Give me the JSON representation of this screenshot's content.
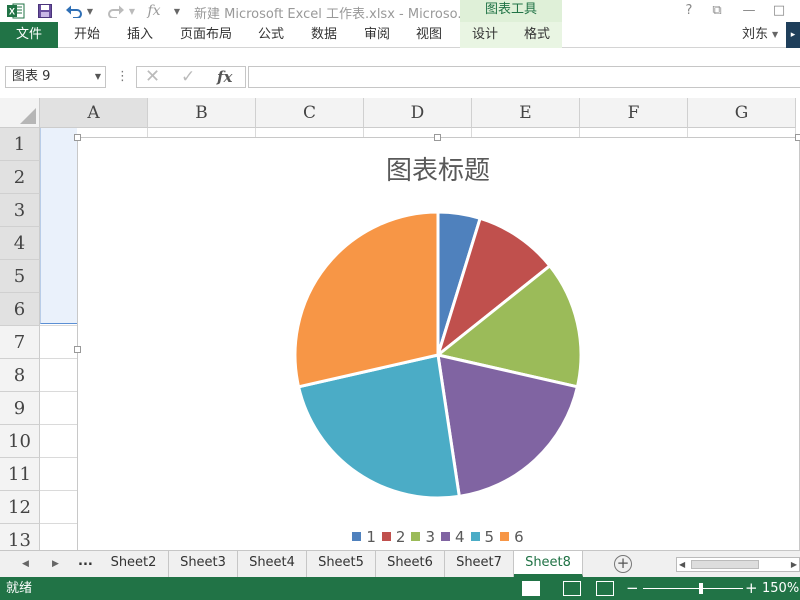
{
  "titlebar": {
    "document_title": "新建 Microsoft Excel 工作表.xlsx - Microso...",
    "context_group": "图表工具",
    "fx_label": "fx",
    "help": "?",
    "restore": "⧉",
    "minimize": "—",
    "close": "□"
  },
  "ribbon": {
    "file_tab": "文件",
    "tabs": [
      "开始",
      "插入",
      "页面布局",
      "公式",
      "数据",
      "审阅",
      "视图"
    ],
    "context_tabs": [
      "设计",
      "格式"
    ],
    "user": "刘东",
    "collapse_glyph": "▸"
  },
  "formula_bar": {
    "name_box": "图表 9",
    "grip": "⋮",
    "cancel": "✕",
    "enter": "✓",
    "insert_function": "fx",
    "formula": ""
  },
  "grid": {
    "columns": [
      "A",
      "B",
      "C",
      "D",
      "E",
      "F",
      "G"
    ],
    "rows": [
      "1",
      "2",
      "3",
      "4",
      "5",
      "6",
      "7",
      "8",
      "9",
      "10",
      "11",
      "12",
      "13"
    ],
    "selected_column": "A",
    "selected_rows": [
      "1",
      "2",
      "3",
      "4",
      "5",
      "6"
    ]
  },
  "chart_data": {
    "type": "pie",
    "title": "图表标题",
    "categories": [
      "1",
      "2",
      "3",
      "4",
      "5",
      "6"
    ],
    "values": [
      1,
      2,
      3,
      4,
      5,
      6
    ],
    "colors": [
      "#4f81bd",
      "#c0504d",
      "#9bbb59",
      "#8064a2",
      "#4bacc6",
      "#f79646"
    ],
    "legend_position": "bottom"
  },
  "sheet_tabs": {
    "ellipsis": "...",
    "tabs": [
      "Sheet2",
      "Sheet3",
      "Sheet4",
      "Sheet5",
      "Sheet6",
      "Sheet7",
      "Sheet8"
    ],
    "active": "Sheet8",
    "add_sheet": "+"
  },
  "status_bar": {
    "status": "就绪",
    "zoom_minus": "−",
    "zoom_plus": "+",
    "zoom": "150%",
    "zoom_value": 150
  },
  "colors": {
    "excel_green": "#217346",
    "context_tab_bg": "#dff0d8"
  }
}
